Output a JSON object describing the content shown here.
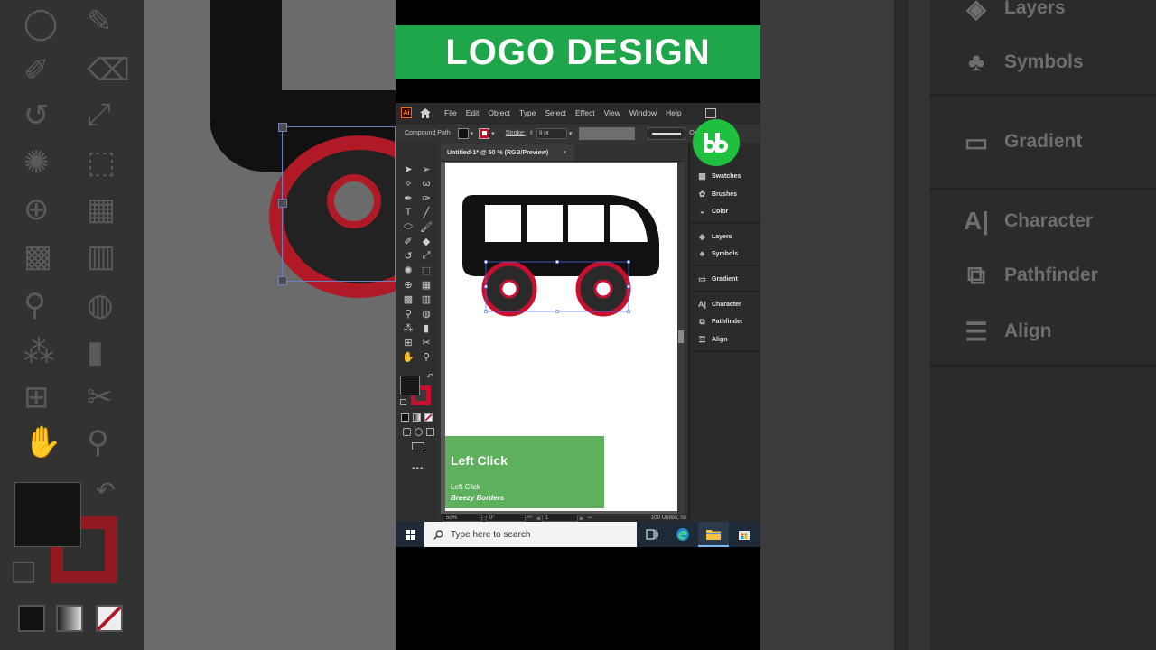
{
  "banner": {
    "title": "LOGO DESIGN"
  },
  "menubar": {
    "app_icon": "Ai",
    "items": [
      "File",
      "Edit",
      "Object",
      "Type",
      "Select",
      "Effect",
      "View",
      "Window",
      "Help"
    ]
  },
  "control_bar": {
    "selection_type": "Compound Path",
    "stroke_label": "Stroke:",
    "stroke_weight": "9 pt",
    "opacity_label": "Opacity:",
    "opacity_value": "10"
  },
  "document": {
    "tab_title": "Untitled-1* @ 50 % (RGB/Preview)",
    "close": "×"
  },
  "status_bar": {
    "zoom": "50%",
    "rotation": "0°",
    "artboard": "1",
    "undos": "100 Undos; no"
  },
  "right_panel": {
    "items": [
      {
        "label": "Swatches",
        "icon": "swatches-icon"
      },
      {
        "label": "Brushes",
        "icon": "brushes-icon"
      },
      {
        "label": "Color",
        "icon": "color-icon"
      },
      {
        "label": "Layers",
        "icon": "layers-icon"
      },
      {
        "label": "Symbols",
        "icon": "symbols-icon"
      },
      {
        "label": "Gradient",
        "icon": "gradient-icon"
      },
      {
        "label": "Character",
        "icon": "character-icon"
      },
      {
        "label": "Pathfinder",
        "icon": "pathfinder-icon"
      },
      {
        "label": "Align",
        "icon": "align-icon"
      }
    ]
  },
  "backdrop_right": {
    "items": [
      "Layers",
      "Symbols",
      "Gradient",
      "Character",
      "Pathfinder",
      "Align"
    ]
  },
  "overlay": {
    "title": "Left Click",
    "subtitle": "Left Click",
    "brand": "Breezy Borders"
  },
  "taskbar": {
    "search_placeholder": "Type here to search"
  },
  "colors": {
    "banner_green": "#1fa64a",
    "stroke_red": "#c8102e",
    "fill_black": "#111111",
    "overlay_green": "#5fb05c",
    "badge_green": "#1fbf3f"
  }
}
